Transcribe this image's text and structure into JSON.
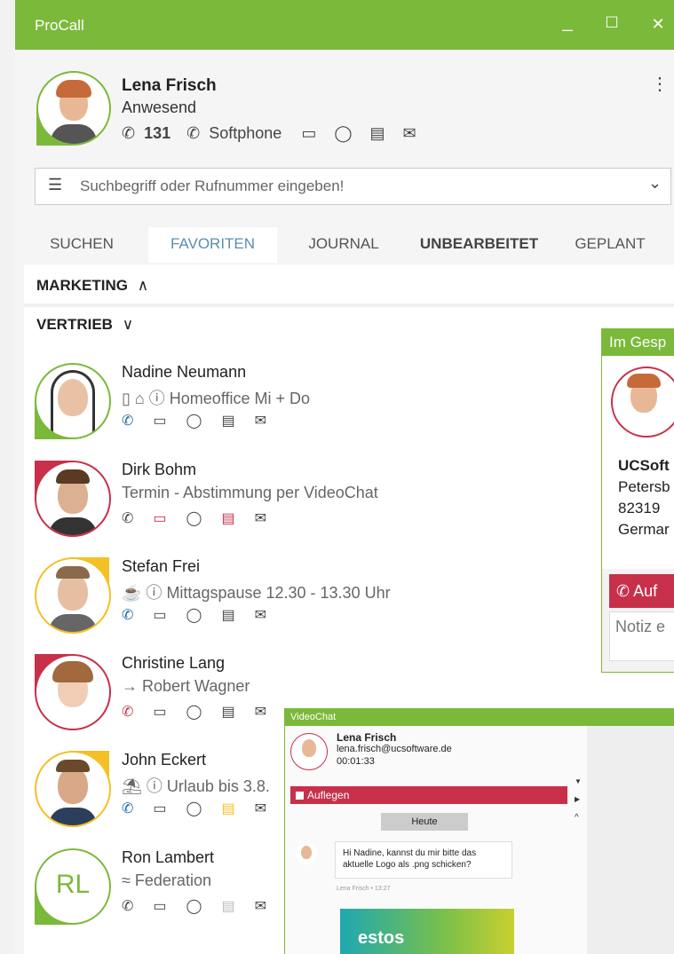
{
  "app": {
    "title": "ProCall"
  },
  "window_controls": {
    "minimize": "_",
    "maximize": "☐",
    "close": "✕"
  },
  "user": {
    "name": "Lena Frisch",
    "status": "Anwesend",
    "extension": "131",
    "phone_label": "Softphone",
    "more": "⋮"
  },
  "search": {
    "placeholder": "Suchbegriff oder Rufnummer eingeben!",
    "dropdown": "⌄"
  },
  "tabs": [
    {
      "label": "SUCHEN"
    },
    {
      "label": "FAVORITEN"
    },
    {
      "label": "JOURNAL"
    },
    {
      "label": "UNBEARBEITET"
    },
    {
      "label": "GEPLANT"
    }
  ],
  "groups": [
    {
      "label": "MARKETING",
      "chevron": "∧"
    },
    {
      "label": "VERTRIEB",
      "chevron": "∨"
    }
  ],
  "contacts": [
    {
      "name": "Nadine Neumann",
      "status": "Homeoffice Mi + Do",
      "status_icons": "▯ ⌂ ⓘ",
      "ring_color": "#7bb93a"
    },
    {
      "name": "Dirk Bohm",
      "status": "Termin - Abstimmung per VideoChat",
      "status_icons": "",
      "ring_color": "#c8304a"
    },
    {
      "name": "Stefan Frei",
      "status": "Mittagspause 12.30 - 13.30 Uhr",
      "status_icons": "☕ ⓘ",
      "ring_color": "#f4c025"
    },
    {
      "name": "Christine Lang",
      "status": "Robert Wagner",
      "status_icons": "→",
      "ring_color": "#c8304a"
    },
    {
      "name": "John Eckert",
      "status": "Urlaub bis 3.8.",
      "status_icons": "⛱ ⓘ",
      "ring_color": "#f4c025"
    },
    {
      "name": "Ron Lambert",
      "status": "Federation",
      "status_icons": "≈",
      "ring_color": "#7bb93a",
      "initials": "RL"
    }
  ],
  "call_popup": {
    "title": "Im Gesp",
    "company": "UCSoft",
    "line1": "Petersb",
    "line2": "82319",
    "line3": "Germar",
    "hangup_label": "Auf",
    "note_placeholder": "Notiz e"
  },
  "videochat": {
    "title": "VideoChat",
    "caller_name": "Lena Frisch",
    "caller_email": "lena.frisch@ucsoftware.de",
    "duration": "00:01:33",
    "hangup_label": "Auflegen",
    "date_label": "Heute",
    "message": "Hi Nadine, kannst du mir bitte das aktuelle Logo als .png schicken?",
    "message_meta": "Lena Frisch • 13:27",
    "logo_text": "estos"
  },
  "colors": {
    "accent": "#7bb93a",
    "red": "#c8304a",
    "yellow": "#f4c025",
    "tab_active_text": "#5a8fb0"
  }
}
